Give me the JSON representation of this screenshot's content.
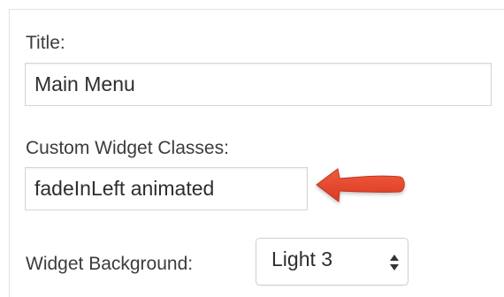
{
  "form": {
    "title_label": "Title:",
    "title_value": "Main Menu",
    "classes_label": "Custom Widget Classes:",
    "classes_value": "fadeInLeft animated",
    "background_label": "Widget Background:",
    "background_value": "Light 3"
  },
  "annotation": {
    "arrow_color": "#e8432b",
    "icon": "red-arrow-left-icon"
  },
  "select_icon": "updown-chevron-icon"
}
